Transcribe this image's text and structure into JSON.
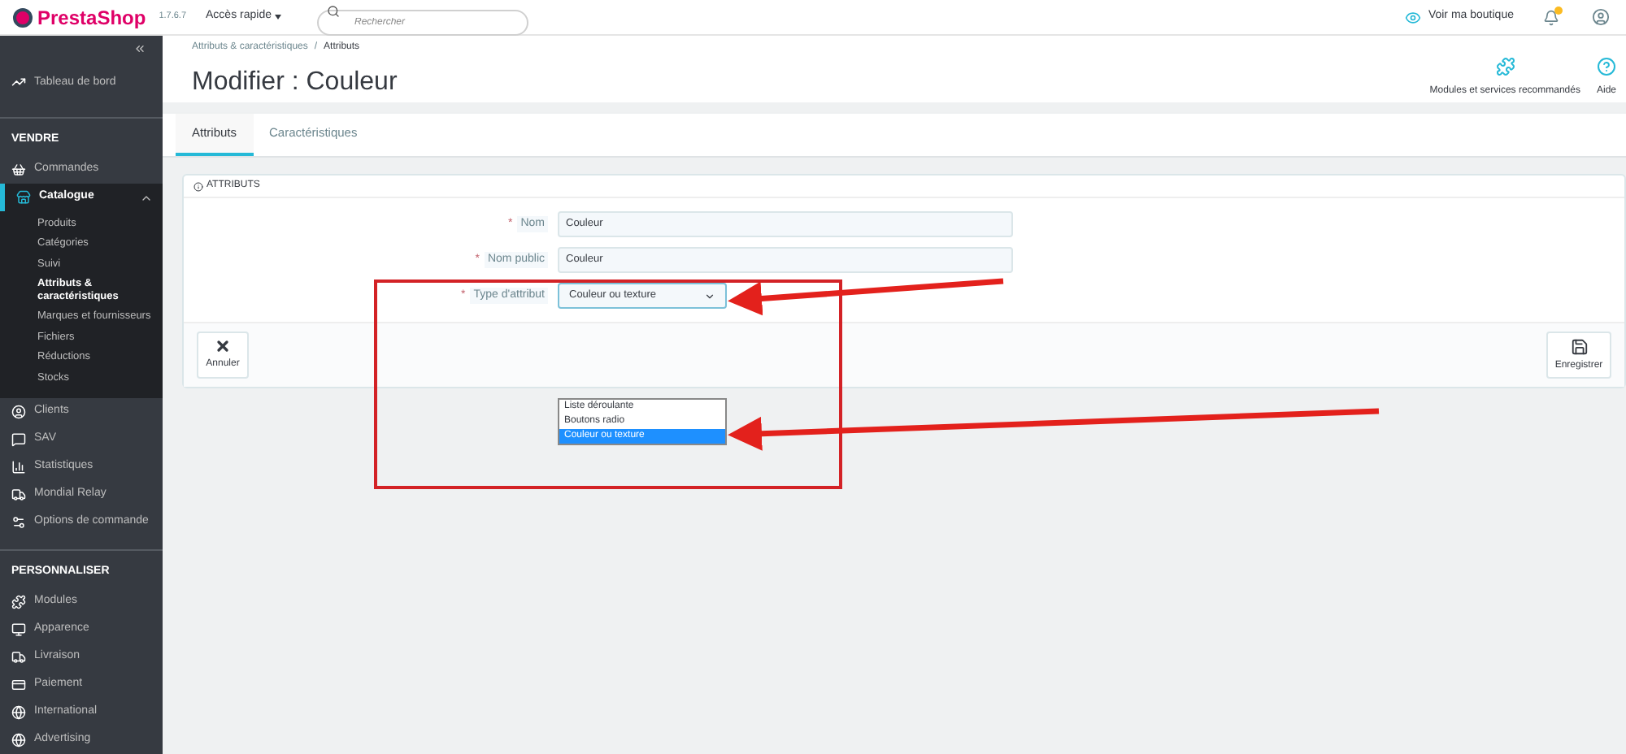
{
  "topbar": {
    "logo": "PrestaShop",
    "version": "1.7.6.7",
    "quick_access": "Accès rapide",
    "search": {
      "placeholder": "Rechercher"
    },
    "view_shop": "Voir ma boutique"
  },
  "sidebar": {
    "dashboard": "Tableau de bord",
    "sections": [
      {
        "title": "VENDRE",
        "items": [
          {
            "label": "Commandes",
            "expanded": false,
            "selected": false
          },
          {
            "label": "Catalogue",
            "expanded": true,
            "selected": true,
            "children": [
              {
                "label": "Produits",
                "selected": false
              },
              {
                "label": "Catégories",
                "selected": false
              },
              {
                "label": "Suivi",
                "selected": false
              },
              {
                "label": "Attributs & caractéristiques",
                "selected": true
              },
              {
                "label": "Marques et fournisseurs",
                "selected": false
              },
              {
                "label": "Fichiers",
                "selected": false
              },
              {
                "label": "Réductions",
                "selected": false
              },
              {
                "label": "Stocks",
                "selected": false
              }
            ]
          },
          {
            "label": "Clients",
            "expanded": false,
            "selected": false
          },
          {
            "label": "SAV",
            "expanded": false,
            "selected": false
          },
          {
            "label": "Statistiques",
            "expanded": false,
            "selected": false
          },
          {
            "label": "Mondial Relay",
            "expanded": false,
            "selected": false
          },
          {
            "label": "Options de commande",
            "expanded": false,
            "selected": false
          }
        ]
      },
      {
        "title": "PERSONNALISER",
        "items": [
          {
            "label": "Modules",
            "expanded": false,
            "selected": false
          },
          {
            "label": "Apparence",
            "expanded": false,
            "selected": false
          },
          {
            "label": "Livraison",
            "expanded": false,
            "selected": false
          },
          {
            "label": "Paiement",
            "expanded": false,
            "selected": false
          },
          {
            "label": "International",
            "expanded": false,
            "selected": false
          },
          {
            "label": "Advertising",
            "expanded": false,
            "selected": false
          }
        ]
      }
    ]
  },
  "header": {
    "breadcrumb": [
      "Attributs & caractéristiques",
      "Attributs"
    ],
    "breadcrumb_separator": "/",
    "title": "Modifier : Couleur",
    "actions": [
      {
        "label": "Modules et services recommandés"
      },
      {
        "label": "Aide"
      }
    ]
  },
  "tabs": [
    {
      "label": "Attributs",
      "selected": true
    },
    {
      "label": "Caractéristiques",
      "selected": false
    }
  ],
  "panel": {
    "title": "ATTRIBUTS",
    "fields": [
      {
        "kind": "text",
        "label": "Nom",
        "required_mark": "*",
        "value": "Couleur"
      },
      {
        "kind": "text",
        "label": "Nom public",
        "required_mark": "*",
        "value": "Couleur"
      },
      {
        "kind": "select",
        "label": "Type d'attribut",
        "required_mark": "*",
        "value": "Couleur ou texture"
      }
    ],
    "cancel": "Annuler",
    "save": "Enregistrer"
  },
  "dropdown": {
    "options": [
      {
        "label": "Liste déroulante",
        "selected": false
      },
      {
        "label": "Boutons radio",
        "selected": false
      },
      {
        "label": "Couleur ou texture",
        "selected": true
      }
    ]
  }
}
